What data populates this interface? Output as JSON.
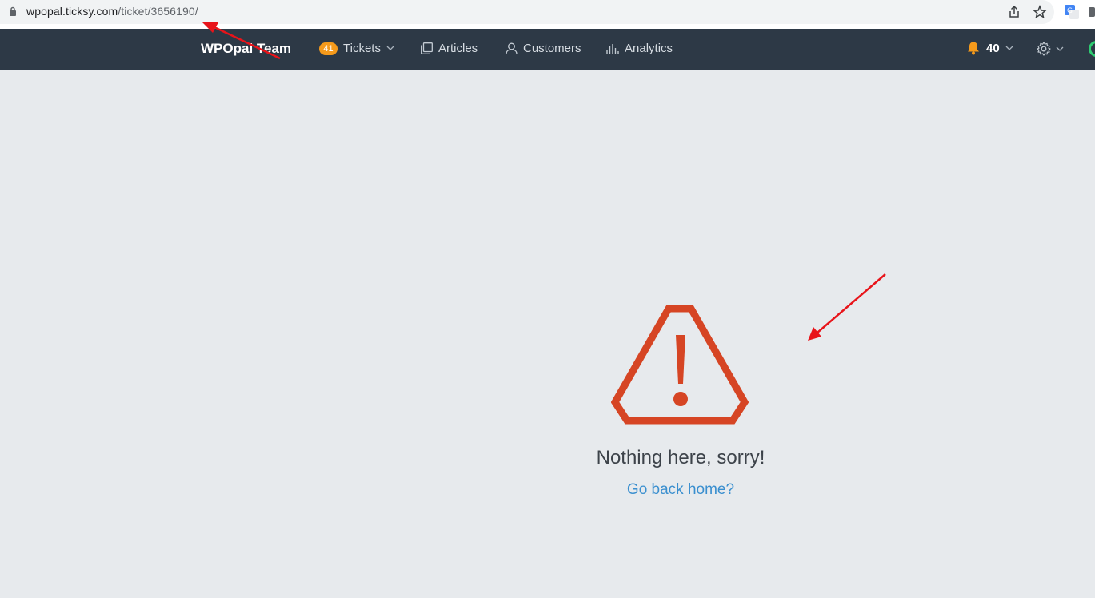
{
  "browser": {
    "url_host": "wpopal.ticksy.com",
    "url_path": "/ticket/3656190/"
  },
  "nav": {
    "brand": "WPOpal Team",
    "items": [
      {
        "label": "Tickets",
        "badge": "41",
        "icon": "tickets-chevron"
      },
      {
        "label": "Articles",
        "icon": "articles-icon"
      },
      {
        "label": "Customers",
        "icon": "user-icon"
      },
      {
        "label": "Analytics",
        "icon": "analytics-icon"
      }
    ],
    "notifications": "40"
  },
  "main": {
    "message": "Nothing here, sorry!",
    "home_link": "Go back home?"
  },
  "colors": {
    "navbar": "#2d3946",
    "warning": "#d64524",
    "link": "#3a8fcf",
    "badge": "#f59a1b",
    "annotation": "#e8141a"
  }
}
